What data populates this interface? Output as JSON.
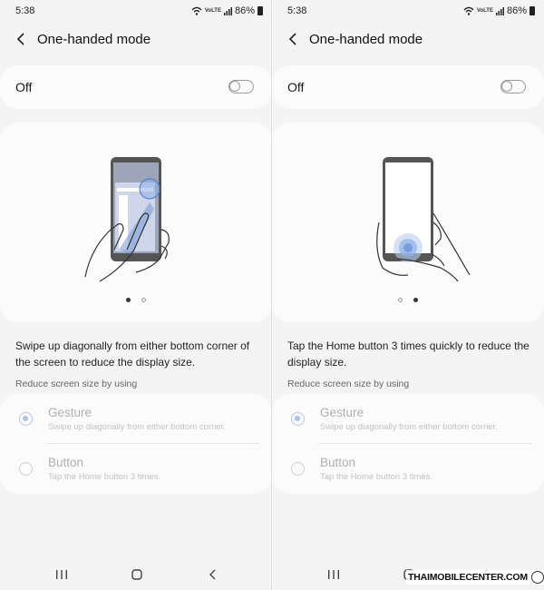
{
  "colors": {
    "accent": "#aac2ec",
    "card_bg": "#fbfbfb",
    "page_bg": "#f4f4f4",
    "disabled_text": "#b0b0b0"
  },
  "screens": [
    {
      "status": {
        "time": "5:38",
        "volte": "VoLTE",
        "battery": "86%"
      },
      "title": "One-handed mode",
      "toggle": {
        "label": "Off",
        "state": "off"
      },
      "illustration": {
        "name": "swipe-gesture-illustration",
        "active_dot": 0
      },
      "description": "Swipe up diagonally from either bottom corner of the screen to reduce the display size.",
      "section_header": "Reduce screen size by using",
      "options": [
        {
          "title": "Gesture",
          "subtitle": "Swipe up diagonally from either bottom corner.",
          "selected": true
        },
        {
          "title": "Button",
          "subtitle": "Tap the Home button 3 times.",
          "selected": false
        }
      ]
    },
    {
      "status": {
        "time": "5:38",
        "volte": "VoLTE",
        "battery": "86%"
      },
      "title": "One-handed mode",
      "toggle": {
        "label": "Off",
        "state": "off"
      },
      "illustration": {
        "name": "home-button-tap-illustration",
        "active_dot": 1
      },
      "description": "Tap the Home button 3 times quickly to reduce the display size.",
      "section_header": "Reduce screen size by using",
      "options": [
        {
          "title": "Gesture",
          "subtitle": "Swipe up diagonally from either bottom corner.",
          "selected": true
        },
        {
          "title": "Button",
          "subtitle": "Tap the Home button 3 times.",
          "selected": false
        }
      ]
    }
  ],
  "navbar": {
    "icons": [
      "recents-icon",
      "home-icon",
      "back-icon"
    ]
  },
  "watermark": {
    "text": "THAIMOBILECENTER.COM"
  }
}
